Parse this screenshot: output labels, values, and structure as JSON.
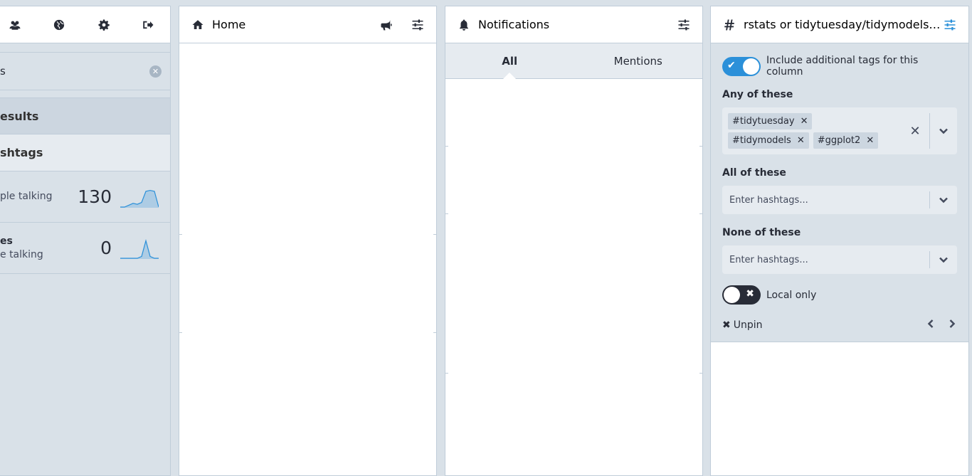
{
  "nav": {
    "icons": [
      "people-icon",
      "globe-icon",
      "gear-icon",
      "sign-out-icon"
    ]
  },
  "search": {
    "value": "s"
  },
  "search_results": {
    "results_label": "esults",
    "hashtags_label": "shtags",
    "items": [
      {
        "name": "",
        "subtitle": "ple talking",
        "count": "130",
        "trend": [
          0,
          0,
          0.1,
          0.2,
          0.15,
          0.25,
          0.85,
          0.9,
          0.85,
          0
        ]
      },
      {
        "name": "es",
        "subtitle": "e talking",
        "count": "0",
        "trend": [
          0,
          0,
          0,
          0,
          0,
          0.1,
          0.95,
          0.1,
          0,
          0
        ]
      }
    ]
  },
  "home": {
    "title": "Home"
  },
  "notifications": {
    "title": "Notifications",
    "tabs": [
      "All",
      "Mentions"
    ],
    "active_tab": "All"
  },
  "hashtag_column": {
    "title": "rstats or tidytuesday/tidymodels/...",
    "include_toggle_label": "Include additional tags for this column",
    "any_label": "Any of these",
    "any_tags": [
      "#tidytuesday",
      "#tidymodels",
      "#ggplot2"
    ],
    "all_label": "All of these",
    "all_placeholder": "Enter hashtags...",
    "none_label": "None of these",
    "none_placeholder": "Enter hashtags...",
    "local_only_label": "Local only",
    "unpin_label": "Unpin"
  },
  "colors": {
    "accent": "#2b90d9",
    "panel_bg": "#d9e1e8",
    "text": "#282c37"
  }
}
